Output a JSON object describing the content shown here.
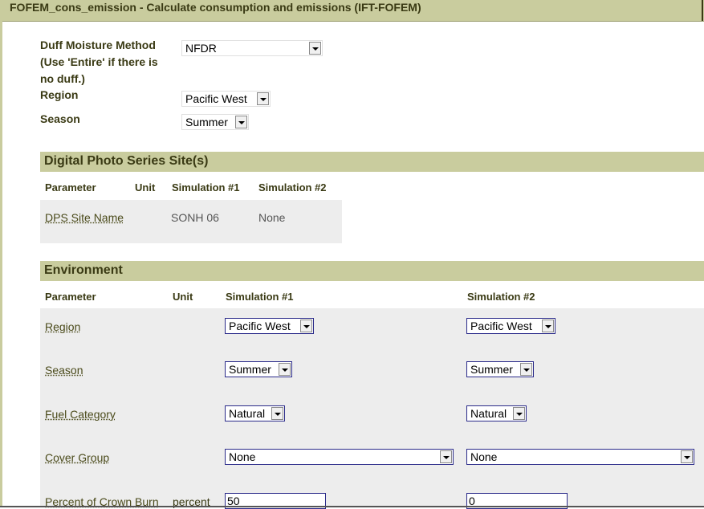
{
  "title": "FOFEM_cons_emission - Calculate consumption and emissions (IFT-FOFEM)",
  "options": {
    "duff_label_1": "Duff Moisture Method",
    "duff_label_2": "(Use 'Entire' if there is",
    "duff_label_3": "no duff.)",
    "duff_value": "NFDR",
    "region_label": "Region",
    "region_value": "Pacific West",
    "season_label": "Season",
    "season_value": "Summer"
  },
  "dps": {
    "header": "Digital Photo Series Site(s)",
    "columns": [
      "Parameter",
      "Unit",
      "Simulation #1",
      "Simulation #2"
    ],
    "rows": [
      {
        "param": "DPS Site Name",
        "unit": "",
        "sim1": "SONH 06",
        "sim2": "None"
      }
    ]
  },
  "environment": {
    "header": "Environment",
    "columns": [
      "Parameter",
      "Unit",
      "Simulation #1",
      "Simulation #2"
    ],
    "rows": [
      {
        "param": "Region",
        "unit": "",
        "sim1": "Pacific West",
        "sim2": "Pacific West"
      },
      {
        "param": "Season",
        "unit": "",
        "sim1": "Summer",
        "sim2": "Summer"
      },
      {
        "param": "Fuel Category",
        "unit": "",
        "sim1": "Natural",
        "sim2": "Natural"
      },
      {
        "param": "Cover Group",
        "unit": "",
        "sim1": "None",
        "sim2": "None"
      },
      {
        "param": "Percent of Crown Burn",
        "unit": "percent",
        "sim1": "50",
        "sim2": "0"
      }
    ]
  },
  "colors": {
    "section_bg": "#c9cc9e",
    "section_text": "#3a3a14",
    "row_bg": "#ededed",
    "input_border": "#2b2b8a"
  }
}
